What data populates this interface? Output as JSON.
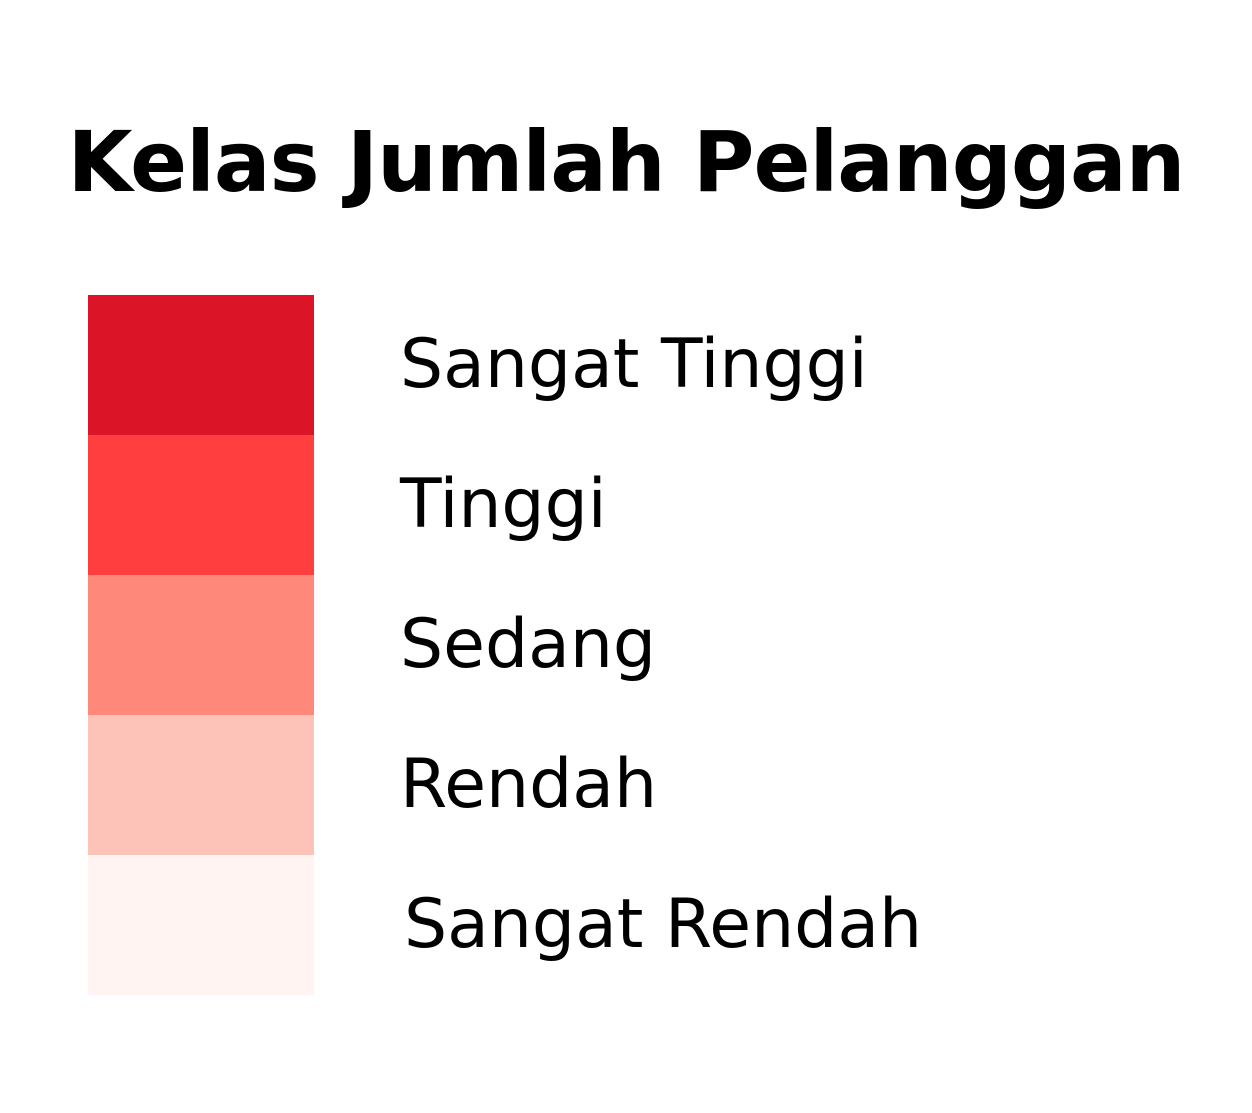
{
  "legend": {
    "title": "Kelas Jumlah Pelanggan",
    "items": [
      {
        "label": "Sangat Tinggi",
        "color": "#dc1428"
      },
      {
        "label": "Tinggi",
        "color": "#ff3f3f"
      },
      {
        "label": "Sedang",
        "color": "#fe897b"
      },
      {
        "label": "Rendah",
        "color": "#fec3b8"
      },
      {
        "label": "Sangat Rendah",
        "color": "#fff4f2"
      }
    ]
  }
}
